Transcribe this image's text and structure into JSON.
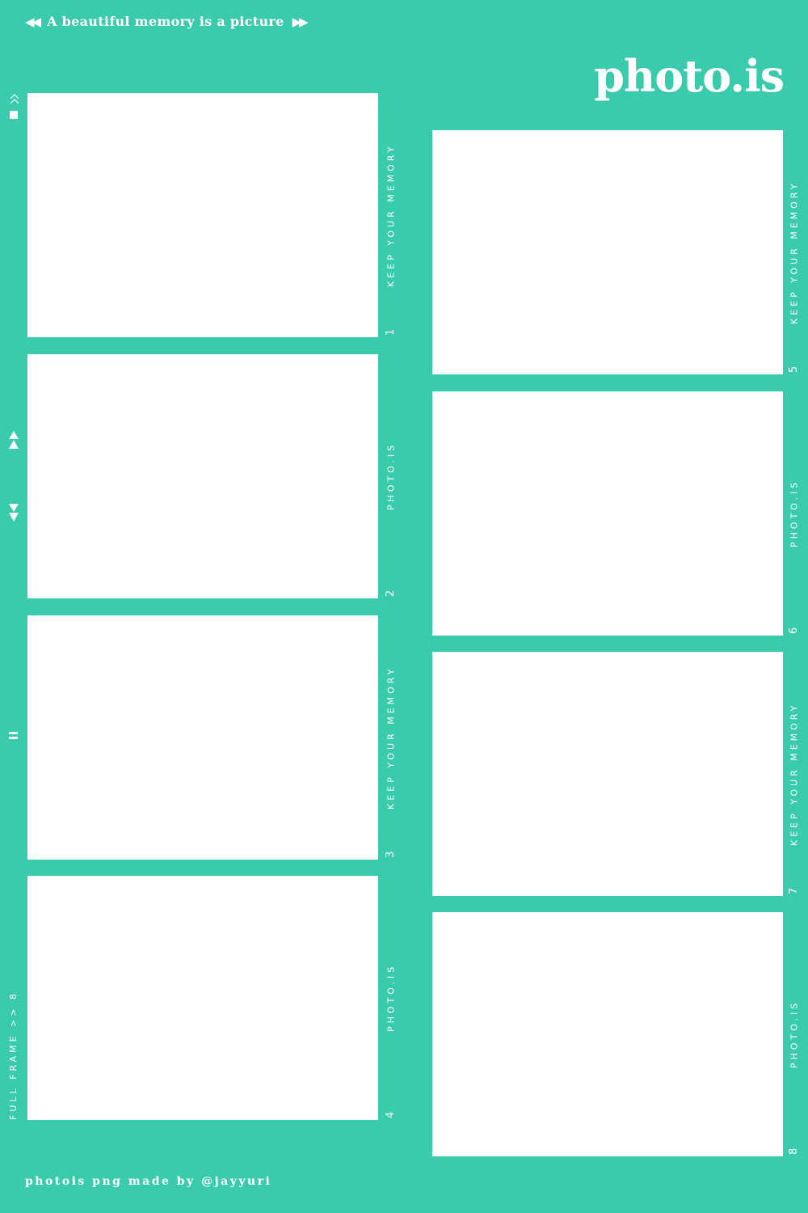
{
  "header": {
    "tagline": "A beautiful memory is a picture",
    "rewind_icon": "◀◀",
    "forward_icon": "▶▶"
  },
  "brand": "photo.is",
  "frames": [
    {
      "number": "1",
      "label": "KEEP YOUR MEMORY"
    },
    {
      "number": "2",
      "label": "PHOTO.IS"
    },
    {
      "number": "3",
      "label": "KEEP YOUR MEMORY"
    },
    {
      "number": "4",
      "label": "PHOTO.IS"
    },
    {
      "number": "5",
      "label": "KEEP YOUR MEMORY"
    },
    {
      "number": "6",
      "label": "PHOTO.IS"
    },
    {
      "number": "7",
      "label": "KEEP YOUR MEMORY"
    },
    {
      "number": "8",
      "label": "PHOTO.IS"
    }
  ],
  "sidebar": {
    "full_frame": "FULL FRAME >> 8"
  },
  "footer": "photois png made by @jayyuri",
  "colors": {
    "background": "#3acbac",
    "frame": "#ffffff"
  }
}
